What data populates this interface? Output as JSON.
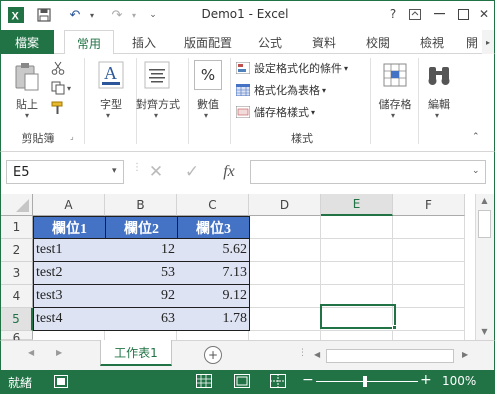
{
  "window": {
    "title": "Demo1 - Excel",
    "help": "?"
  },
  "tabs": {
    "file": "檔案",
    "items": [
      "常用",
      "插入",
      "版面配置",
      "公式",
      "資料",
      "校閱",
      "檢視",
      "開"
    ]
  },
  "ribbon": {
    "clipboard": {
      "paste": "貼上",
      "group": "剪貼簿"
    },
    "font": "字型",
    "alignment": "對齊方式",
    "number": {
      "label": "數值",
      "icon_text": "%"
    },
    "styles": {
      "conditional": "設定格式化的條件",
      "as_table": "格式化為表格",
      "cell_styles": "儲存格樣式",
      "group": "樣式"
    },
    "cells": "儲存格",
    "editing": "編輯"
  },
  "formula_bar": {
    "name_box": "E5",
    "fx": "fx",
    "content": ""
  },
  "columns": [
    "A",
    "B",
    "C",
    "D",
    "E",
    "F"
  ],
  "rows": [
    "1",
    "2",
    "3",
    "4",
    "5",
    "6"
  ],
  "table": {
    "headers": [
      "欄位1",
      "欄位2",
      "欄位3"
    ],
    "rows": [
      [
        "test1",
        "12",
        "5.62"
      ],
      [
        "test2",
        "53",
        "7.13"
      ],
      [
        "test3",
        "92",
        "9.12"
      ],
      [
        "test4",
        "63",
        "1.78"
      ]
    ]
  },
  "sheets": {
    "active": "工作表1"
  },
  "status": {
    "ready": "就緒",
    "zoom": "100%"
  },
  "colors": {
    "excel_green": "#217346",
    "table_header": "#4472c4",
    "table_band": "#dde3f3"
  }
}
